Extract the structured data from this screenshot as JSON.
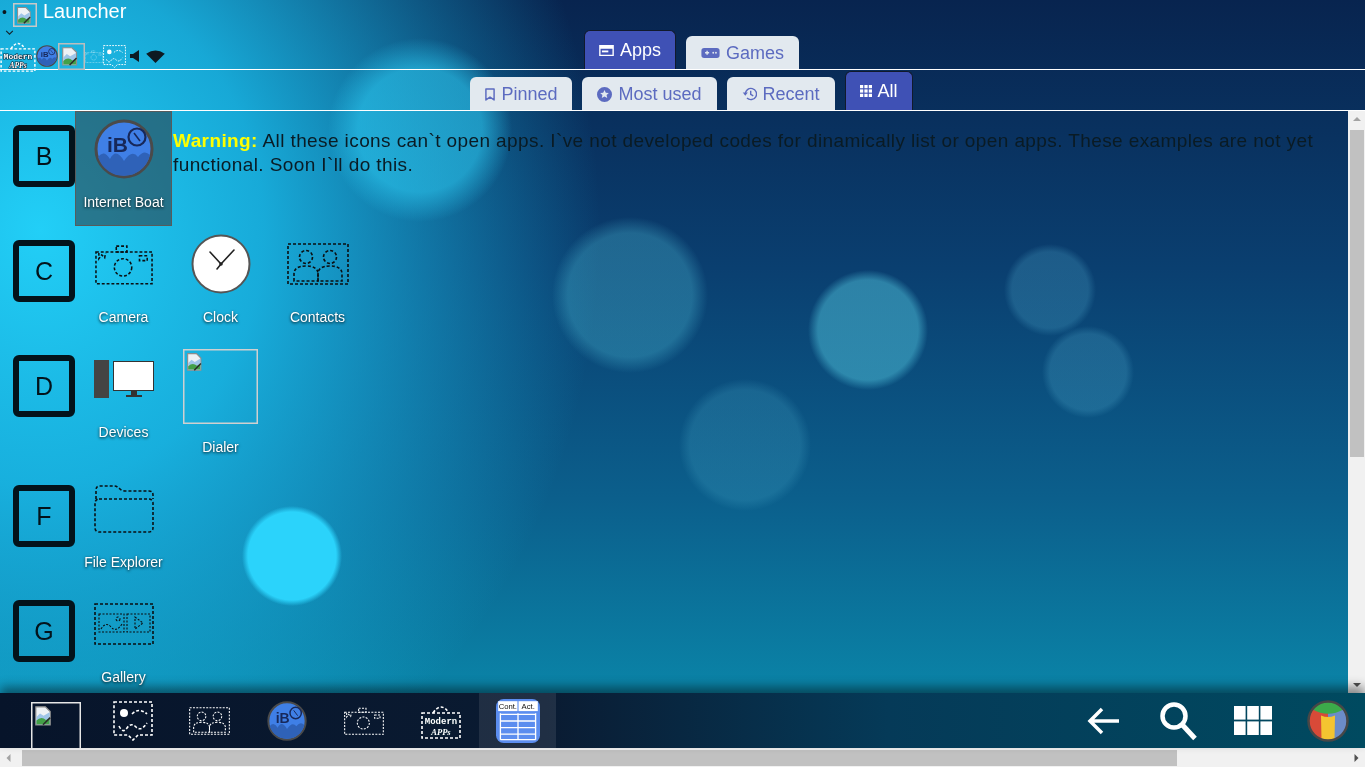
{
  "header": {
    "bullet": "•",
    "title": "Launcher",
    "quick_icons": [
      {
        "kind": "sign",
        "lines": [
          "Modern",
          "APPs"
        ]
      },
      {
        "kind": "boat",
        "monogram": "iB"
      },
      {
        "kind": "image"
      },
      {
        "kind": "camera"
      },
      {
        "kind": "photo"
      },
      {
        "kind": "speaker"
      },
      {
        "kind": "wifi"
      }
    ]
  },
  "main_tabs": [
    {
      "label": "Apps",
      "selected": true
    },
    {
      "label": "Games",
      "selected": false
    }
  ],
  "sub_tabs": [
    {
      "label": "Pinned",
      "selected": false
    },
    {
      "label": "Most used",
      "selected": false
    },
    {
      "label": "Recent",
      "selected": false
    },
    {
      "label": "All",
      "selected": true
    }
  ],
  "warning": "**Warning:** All these icons can`t open apps. I`ve not developed codes for dinamically list or open apps. These examples are not yet functional. Soon I`ll do this.",
  "groups": [
    {
      "letter": "B",
      "apps": [
        {
          "name": "Internet Boat",
          "kind": "boat",
          "monogram": "iB",
          "selected": true
        }
      ]
    },
    {
      "letter": "C",
      "apps": [
        {
          "name": "Camera",
          "kind": "camera",
          "selected": false
        },
        {
          "name": "Clock",
          "kind": "clock",
          "selected": false
        },
        {
          "name": "Contacts",
          "kind": "contacts",
          "selected": false
        }
      ]
    },
    {
      "letter": "D",
      "apps": [
        {
          "name": "Devices",
          "kind": "devices",
          "selected": false
        },
        {
          "name": "Dialer",
          "kind": "image",
          "selected": false
        }
      ]
    },
    {
      "letter": "F",
      "apps": [
        {
          "name": "File Explorer",
          "kind": "folder",
          "selected": false
        }
      ]
    },
    {
      "letter": "G",
      "apps": [
        {
          "name": "Gallery",
          "kind": "gallery",
          "selected": false
        }
      ]
    }
  ],
  "taskbar": {
    "apps": [
      {
        "kind": "image",
        "selected": false
      },
      {
        "kind": "photo",
        "selected": false
      },
      {
        "kind": "contacts",
        "selected": false
      },
      {
        "kind": "boat",
        "monogram": "iB",
        "selected": false
      },
      {
        "kind": "camera",
        "selected": false
      },
      {
        "kind": "sign",
        "lines": [
          "Modern",
          "APPs"
        ],
        "selected": false
      },
      {
        "kind": "sheet",
        "headers": [
          "Cont.",
          "Act."
        ],
        "selected": true
      }
    ]
  }
}
